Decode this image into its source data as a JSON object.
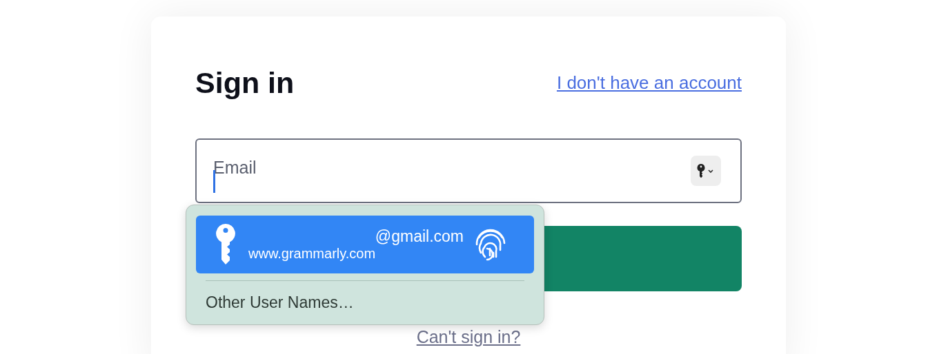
{
  "title": "Sign in",
  "signup_link": "I don't have an account",
  "email_field": {
    "placeholder": "Email",
    "focused": true
  },
  "autofill_popup": {
    "suggestions": [
      {
        "username": "@gmail.com",
        "site": "www.grammarly.com",
        "selected": true
      }
    ],
    "other_option": "Other User Names…"
  },
  "help_link": "Can't sign in?"
}
